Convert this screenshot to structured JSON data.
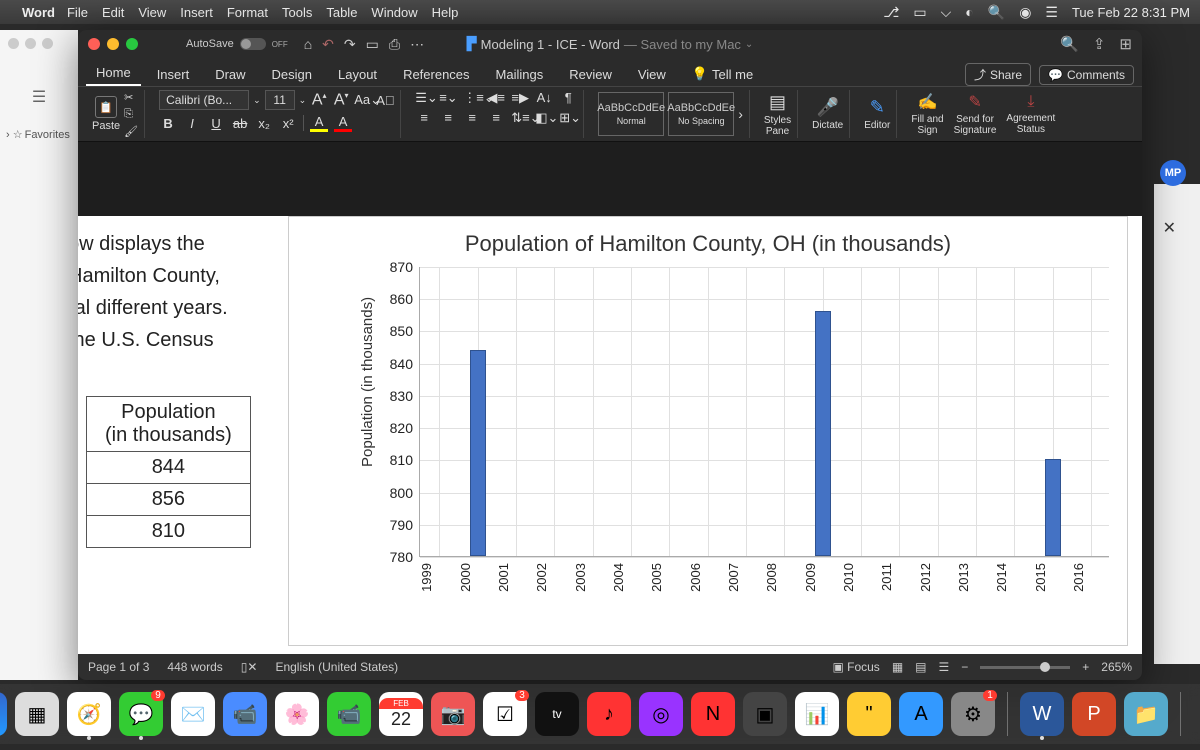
{
  "menubar": {
    "app": "Word",
    "items": [
      "File",
      "Edit",
      "View",
      "Insert",
      "Format",
      "Tools",
      "Table",
      "Window",
      "Help"
    ],
    "clock": "Tue Feb 22  8:31 PM"
  },
  "window": {
    "autosave_label": "AutoSave",
    "autosave_state": "OFF",
    "doc_title": "Modeling 1 - ICE - Word",
    "doc_saved": "— Saved to my Mac",
    "tabs": [
      "Home",
      "Insert",
      "Draw",
      "Design",
      "Layout",
      "References",
      "Mailings",
      "Review",
      "View"
    ],
    "tell_me": "Tell me",
    "share": "Share",
    "comments": "Comments"
  },
  "ribbon": {
    "paste": "Paste",
    "font_name": "Calibri (Bo...",
    "font_size": "11",
    "style_sample": "AaBbCcDdEe",
    "style1": "Normal",
    "style2": "No Spacing",
    "styles_pane": "Styles\nPane",
    "dictate": "Dictate",
    "editor": "Editor",
    "fill_sign": "Fill and\nSign",
    "send_sig": "Send for\nSignature",
    "agreement": "Agreement\nStatus"
  },
  "sidebar": {
    "favorites": "Favorites"
  },
  "document": {
    "body_lines": [
      "ow displays the",
      "Hamilton County,",
      "ral different years.",
      "the U.S. Census"
    ],
    "table_header": "Population\n(in thousands)",
    "table_rows": [
      "844",
      "856",
      "810"
    ]
  },
  "chart_data": {
    "type": "bar",
    "title": "Population of Hamilton County, OH (in thousands)",
    "ylabel": "Population (in thousands)",
    "ylim": [
      780,
      870
    ],
    "yticks": [
      780,
      790,
      800,
      810,
      820,
      830,
      840,
      850,
      860,
      870
    ],
    "categories": [
      "1999",
      "2000",
      "2001",
      "2002",
      "2003",
      "2004",
      "2005",
      "2006",
      "2007",
      "2008",
      "2009",
      "2010",
      "2011",
      "2012",
      "2013",
      "2014",
      "2015",
      "2016"
    ],
    "values": [
      null,
      844,
      null,
      null,
      null,
      null,
      null,
      null,
      null,
      null,
      856,
      null,
      null,
      null,
      null,
      null,
      810,
      null
    ]
  },
  "status": {
    "page": "Page 1 of 3",
    "words": "448 words",
    "lang": "English (United States)",
    "focus": "Focus",
    "zoom": "265%"
  },
  "badge": {
    "initials": "MP"
  },
  "dock": {
    "calendar": {
      "month": "FEB",
      "day": "22"
    },
    "messages_badge": "9",
    "reminders_badge": "3",
    "sysprefs_badge": "1"
  }
}
